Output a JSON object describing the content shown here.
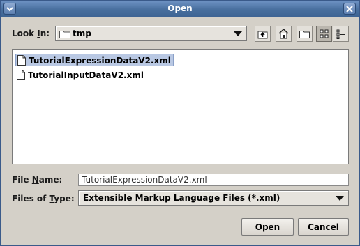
{
  "window": {
    "title": "Open"
  },
  "look_in": {
    "label_pre": "Look ",
    "label_mnemonic": "I",
    "label_post": "n:",
    "value": "tmp",
    "icon": "folder-icon"
  },
  "toolbar": {
    "up_one_level": "up-folder-icon",
    "home": "home-icon",
    "new_folder": "new-folder-icon",
    "list_view": "list-view-icon",
    "details_view": "details-view-icon"
  },
  "files": [
    {
      "name": "TutorialExpressionDataV2.xml",
      "selected": true
    },
    {
      "name": "TutorialInputDataV2.xml",
      "selected": false
    }
  ],
  "file_name": {
    "label_pre": "File ",
    "label_mnemonic": "N",
    "label_post": "ame:",
    "value": "TutorialExpressionDataV2.xml"
  },
  "files_of_type": {
    "label_pre": "Files of ",
    "label_mnemonic": "T",
    "label_post": "ype:",
    "value": "Extensible Markup Language Files (*.xml)"
  },
  "buttons": {
    "open": "Open",
    "cancel": "Cancel"
  },
  "colors": {
    "titlebar": "#486f9e",
    "selection": "#b9c8e3",
    "dialog_bg": "#d4d0c8"
  }
}
